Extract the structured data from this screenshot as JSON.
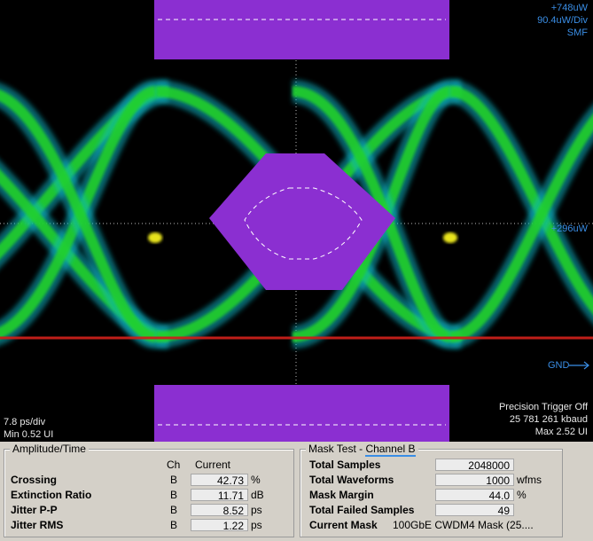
{
  "scope": {
    "top_right": [
      "+748uW",
      "90.4uW/Div",
      "SMF"
    ],
    "mid_right": "+296uW",
    "gnd": "GND",
    "bottom_left": [
      "7.8 ps/div",
      "Min 0.52 UI"
    ],
    "bottom_right": [
      "Precision Trigger Off",
      "25 781 261 kbaud",
      "Max 2.52 UI"
    ],
    "colors": {
      "mask": "#8b2fd1",
      "trace_green": "#22d02a",
      "trace_cyan": "#0fb7c8",
      "trace_yellow": "#e8e41a",
      "trace_red": "#c9201a",
      "axis_blue": "#3a8ee6"
    }
  },
  "amplitude_time": {
    "title": "Amplitude/Time",
    "col_ch": "Ch",
    "col_current": "Current",
    "rows": [
      {
        "name": "Crossing",
        "ch": "B",
        "value": "42.73",
        "unit": "%"
      },
      {
        "name": "Extinction Ratio",
        "ch": "B",
        "value": "11.71",
        "unit": "dB"
      },
      {
        "name": "Jitter P-P",
        "ch": "B",
        "value": "8.52",
        "unit": "ps"
      },
      {
        "name": "Jitter RMS",
        "ch": "B",
        "value": "1.22",
        "unit": "ps"
      }
    ]
  },
  "mask_test": {
    "title": "Mask Test - ",
    "channel": "Channel B",
    "rows": [
      {
        "name": "Total Samples",
        "value": "2048000",
        "unit": ""
      },
      {
        "name": "Total Waveforms",
        "value": "1000",
        "unit": "wfms"
      },
      {
        "name": "Mask Margin",
        "value": "44.0",
        "unit": "%"
      },
      {
        "name": "Total Failed Samples",
        "value": "49",
        "unit": ""
      }
    ],
    "current_mask_label": "Current Mask",
    "current_mask_value": "100GbE  CWDM4  Mask (25...."
  }
}
